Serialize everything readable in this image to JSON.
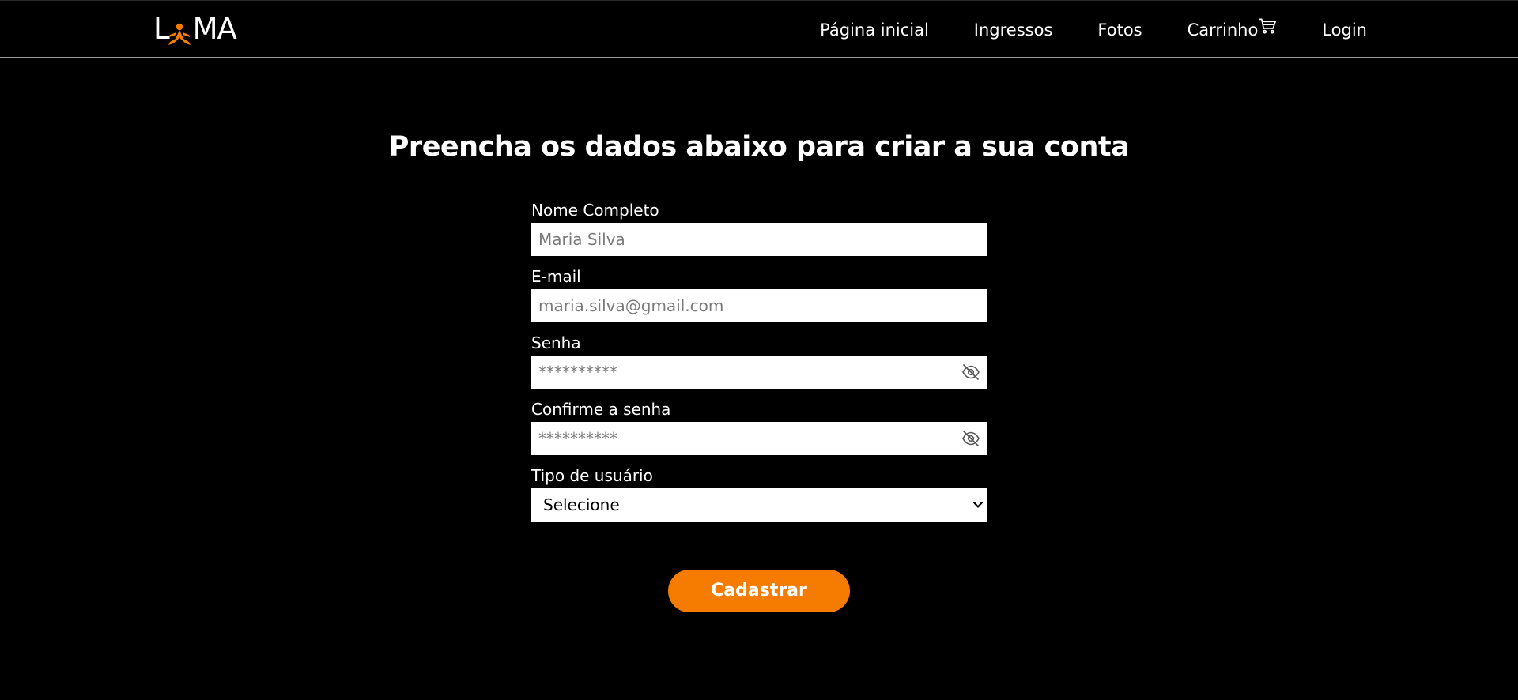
{
  "brand": {
    "logo_left": "L",
    "logo_right": "MA",
    "logo_icon": "lama-figure-logo",
    "accent_color": "#f57c00"
  },
  "nav": {
    "items": [
      {
        "label": "Página inicial"
      },
      {
        "label": "Ingressos"
      },
      {
        "label": "Fotos"
      },
      {
        "label": "Carrinho",
        "icon": "cart-icon"
      },
      {
        "label": "Login"
      }
    ]
  },
  "main": {
    "title": "Preencha os dados abaixo para criar a sua conta"
  },
  "form": {
    "name": {
      "label": "Nome Completo",
      "placeholder": "Maria Silva",
      "value": ""
    },
    "email": {
      "label": "E-mail",
      "placeholder": "maria.silva@gmail.com",
      "value": ""
    },
    "password": {
      "label": "Senha",
      "placeholder": "**********",
      "icon": "eye-slash-icon"
    },
    "confirm_password": {
      "label": "Confirme a senha",
      "placeholder": "**********",
      "icon": "eye-slash-icon"
    },
    "user_type": {
      "label": "Tipo de usuário",
      "selected": "Selecione",
      "icon": "chevron-down-icon"
    },
    "submit_label": "Cadastrar"
  }
}
